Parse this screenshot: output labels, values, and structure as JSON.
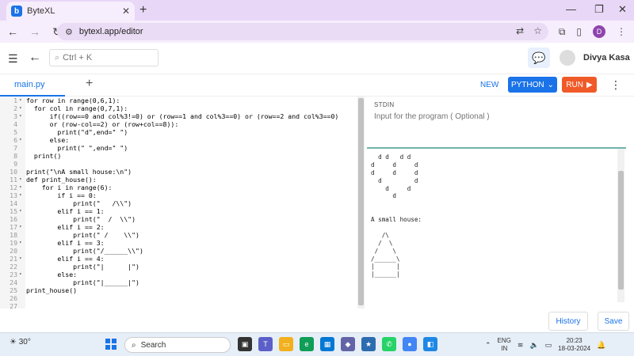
{
  "browser": {
    "tab_title": "ByteXL",
    "favicon_letter": "b",
    "url": "bytexl.app/editor",
    "profile_initial": "D"
  },
  "header": {
    "search_placeholder": "Ctrl + K",
    "username": "Divya Kasa"
  },
  "filebar": {
    "file_tab": "main.py",
    "new_label": "NEW",
    "language": "PYTHON",
    "run_label": "RUN"
  },
  "editor": {
    "lines": [
      {
        "n": "1",
        "fold": "▾",
        "t": "for row in range(0,6,1):"
      },
      {
        "n": "2",
        "fold": "▾",
        "t": "  for col in range(0,7,1):"
      },
      {
        "n": "3",
        "fold": "▾",
        "t": "      if((row==0 and col%3!=0) or (row==1 and col%3==0) or (row==2 and col%3==0)"
      },
      {
        "n": "4",
        "fold": "",
        "t": "      or (row-col==2) or (row+col==8)):"
      },
      {
        "n": "5",
        "fold": "",
        "t": "        print(\"d\",end=\" \")"
      },
      {
        "n": "6",
        "fold": "▾",
        "t": "      else:"
      },
      {
        "n": "7",
        "fold": "",
        "t": "        print(\" \",end=\" \")"
      },
      {
        "n": "8",
        "fold": "",
        "t": "  print()"
      },
      {
        "n": "9",
        "fold": "",
        "t": ""
      },
      {
        "n": "10",
        "fold": "",
        "t": "print(\"\\nA small house:\\n\")"
      },
      {
        "n": "11",
        "fold": "▾",
        "t": "def print_house():"
      },
      {
        "n": "12",
        "fold": "▾",
        "t": "    for i in range(6):"
      },
      {
        "n": "13",
        "fold": "▾",
        "t": "        if i == 0:"
      },
      {
        "n": "14",
        "fold": "",
        "t": "            print(\"   /\\\\\")"
      },
      {
        "n": "15",
        "fold": "▾",
        "t": "        elif i == 1:"
      },
      {
        "n": "16",
        "fold": "",
        "t": "            print(\"  /  \\\\\")"
      },
      {
        "n": "17",
        "fold": "▾",
        "t": "        elif i == 2:"
      },
      {
        "n": "18",
        "fold": "",
        "t": "            print(\" /    \\\\\")"
      },
      {
        "n": "19",
        "fold": "▾",
        "t": "        elif i == 3:"
      },
      {
        "n": "20",
        "fold": "",
        "t": "            print(\"/______\\\\\")"
      },
      {
        "n": "21",
        "fold": "▾",
        "t": "        elif i == 4:"
      },
      {
        "n": "22",
        "fold": "",
        "t": "            print(\"|      |\")"
      },
      {
        "n": "23",
        "fold": "▾",
        "t": "        else:"
      },
      {
        "n": "24",
        "fold": "",
        "t": "            print(\"|______|\")"
      },
      {
        "n": "25",
        "fold": "",
        "t": "print_house()"
      },
      {
        "n": "26",
        "fold": "",
        "t": ""
      },
      {
        "n": "27",
        "fold": "",
        "t": ""
      }
    ]
  },
  "io": {
    "stdin_label": "STDIN",
    "stdin_placeholder": "Input for the program ( Optional )",
    "output_lines": [
      "  d d   d d",
      "d     d     d",
      "d     d     d",
      "  d         d",
      "    d     d",
      "      d",
      "",
      "",
      "A small house:",
      "",
      "   /\\",
      "  /  \\",
      " /    \\",
      "/______\\",
      "|      |",
      "|______|"
    ]
  },
  "actions": {
    "history": "History",
    "save": "Save"
  },
  "taskbar": {
    "weather": "30°",
    "search": "Search",
    "lang_line1": "ENG",
    "lang_line2": "IN",
    "time": "20:23",
    "date": "18-03-2024"
  }
}
